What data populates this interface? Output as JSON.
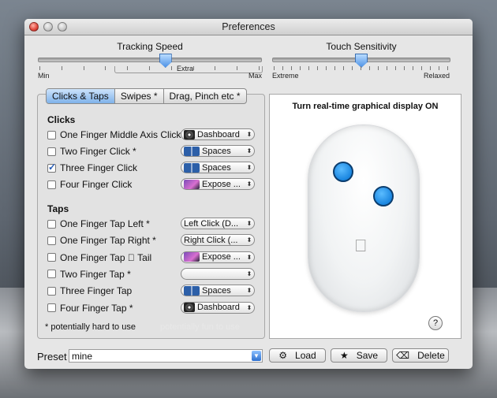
{
  "window": {
    "title": "Preferences"
  },
  "tracking": {
    "title": "Tracking Speed",
    "min": "Min",
    "max": "Max",
    "extra": "Extra",
    "level": 0.57
  },
  "touch": {
    "title": "Touch Sensitivity",
    "left": "Extreme",
    "right": "Relaxed",
    "level": 0.5
  },
  "tabs": [
    "Clicks & Taps",
    "Swipes *",
    "Drag, Pinch etc *"
  ],
  "active_tab": 0,
  "clicks": {
    "heading": "Clicks",
    "rows": [
      {
        "label": "One Finger Middle Axis Click",
        "checked": false,
        "action": "Dashboard",
        "icon": "dashboard-icon"
      },
      {
        "label": "Two Finger Click *",
        "checked": false,
        "action": "Spaces",
        "icon": "spaces-icon"
      },
      {
        "label": "Three Finger Click",
        "checked": true,
        "action": "Spaces",
        "icon": "spaces-icon"
      },
      {
        "label": "Four Finger Click",
        "checked": false,
        "action": "Expose ...",
        "icon": "expose-icon"
      }
    ]
  },
  "taps": {
    "heading": "Taps",
    "rows": [
      {
        "label": "One Finger Tap Left *",
        "checked": false,
        "action": "Left Click (D...",
        "icon": ""
      },
      {
        "label": "One Finger Tap Right *",
        "checked": false,
        "action": "Right Click (...",
        "icon": ""
      },
      {
        "label": "One Finger Tap  Tail",
        "checked": false,
        "action": "Expose ...",
        "icon": "expose-icon"
      },
      {
        "label": "Two Finger Tap *",
        "checked": false,
        "action": "",
        "icon": ""
      },
      {
        "label": "Three Finger Tap",
        "checked": false,
        "action": "Spaces",
        "icon": "spaces-icon"
      },
      {
        "label": "Four Finger Tap *",
        "checked": false,
        "action": "Dashboard",
        "icon": "dashboard-icon"
      }
    ]
  },
  "notes": {
    "hard": "* potentially hard to use",
    "fun": "potentially fun to use"
  },
  "display": {
    "title": "Turn real-time graphical display ON",
    "help": "?"
  },
  "preset": {
    "label": "Preset",
    "value": "mine"
  },
  "buttons": {
    "load": "Load",
    "save": "Save",
    "delete": "Delete"
  }
}
